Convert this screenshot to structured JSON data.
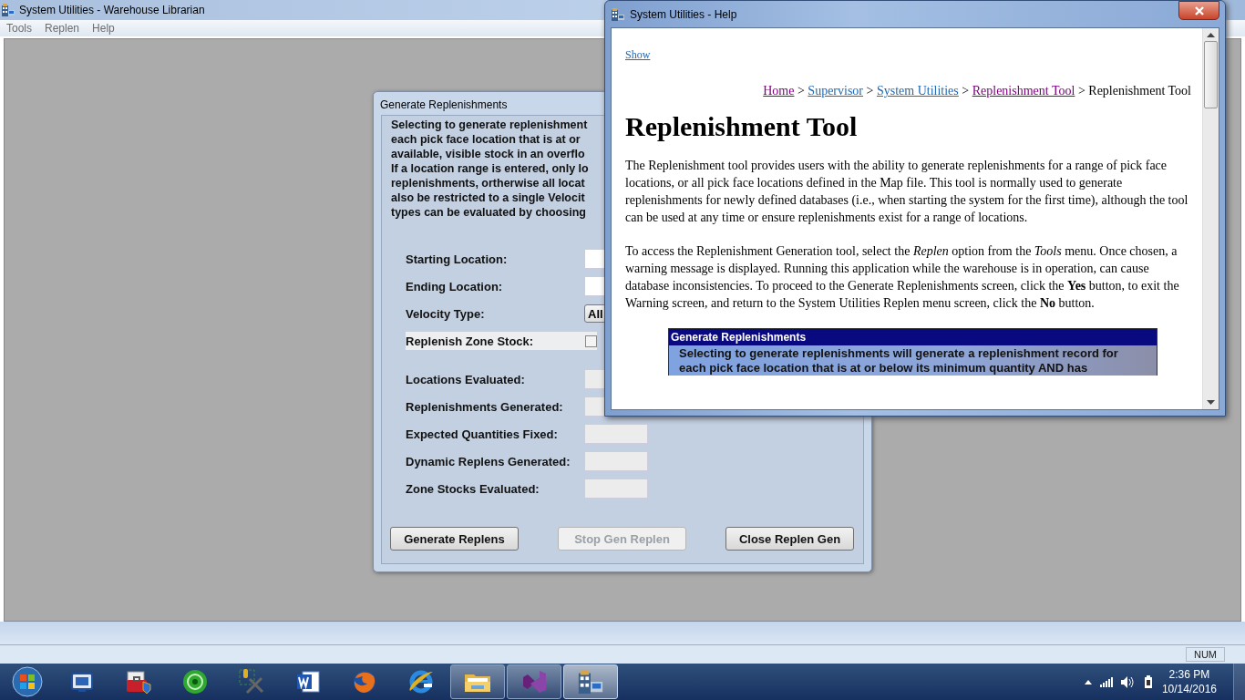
{
  "main_window": {
    "title": "System Utilities - Warehouse Librarian",
    "menu": [
      "Tools",
      "Replen",
      "Help"
    ]
  },
  "dialog": {
    "title": "Generate Replenishments",
    "intro_lines": [
      "Selecting to generate replenishment",
      "each pick face location that is at or",
      "available, visible stock in an overflo",
      "If a location range is entered, only lo",
      "replenishments, ortherwise all locat",
      "also be restricted to a single Velocit",
      "types can be evaluated by choosing"
    ],
    "fields": [
      {
        "label": "Starting Location:",
        "kind": "input"
      },
      {
        "label": "Ending Location:",
        "kind": "input"
      },
      {
        "label": "Velocity Type:",
        "kind": "select",
        "value": "All"
      },
      {
        "label": "Replenish Zone Stock:",
        "kind": "checkbox",
        "checked": false
      }
    ],
    "counters": [
      "Locations Evaluated:",
      "Replenishments Generated:",
      "Expected Quantities Fixed:",
      "Dynamic Replens Generated:",
      "Zone Stocks Evaluated:"
    ],
    "buttons": [
      {
        "label": "Generate Replens",
        "disabled": false
      },
      {
        "label": "Stop Gen Replen",
        "disabled": true
      },
      {
        "label": "Close Replen Gen",
        "disabled": false
      }
    ]
  },
  "help_window": {
    "title": "System Utilities  - Help",
    "show_link": "Show",
    "separator": ">",
    "breadcrumb": [
      {
        "label": "Home",
        "kind": "link",
        "visited": true
      },
      {
        "label": "Supervisor",
        "kind": "link",
        "visited": false
      },
      {
        "label": "System Utilities",
        "kind": "link",
        "visited": false
      },
      {
        "label": "Replenishment Tool",
        "kind": "link",
        "visited": true
      },
      {
        "label": "Replenishment Tool",
        "kind": "current",
        "visited": false
      }
    ],
    "heading": "Replenishment Tool",
    "paragraphs": [
      "The Replenishment tool provides users with the ability to generate replenishments for a range of pick face locations, or all pick face locations defined in the Map file. This tool is normally used to generate replenishments for newly defined databases (i.e., when starting the system for the first time), although the tool can be used at any time or ensure replenishments exist for a range of locations.",
      "To access the Replenishment Generation tool, select the *Replen* option from the *Tools* menu. Once chosen, a warning message is displayed. Running this application while the warehouse is in operation, can cause database inconsistencies. To proceed to the Generate Replenishments screen, click the **Yes** button, to exit the Warning screen, and return to the System Utilities Replen menu screen, click the **No** button."
    ],
    "figure": {
      "title": "Generate Replenishments",
      "lines": [
        "Selecting to generate replenishments will generate a replenishment record for",
        "each pick face location that is at or below its minimum quantity AND has"
      ]
    }
  },
  "status_bar": {
    "indicator": "NUM"
  },
  "taskbar": {
    "apps": [
      {
        "kind": "vb",
        "open": false,
        "active": false
      },
      {
        "kind": "toolbox",
        "open": false,
        "active": false
      },
      {
        "kind": "disc",
        "open": false,
        "active": false
      },
      {
        "kind": "tools",
        "open": false,
        "active": false
      },
      {
        "kind": "word",
        "open": false,
        "active": false
      },
      {
        "kind": "firefox",
        "open": false,
        "active": false
      },
      {
        "kind": "ie",
        "open": false,
        "active": false
      },
      {
        "kind": "folder",
        "open": true,
        "active": false
      },
      {
        "kind": "studio",
        "open": true,
        "active": false
      },
      {
        "kind": "warehouse",
        "open": true,
        "active": true
      }
    ],
    "time": "2:36 PM",
    "date": "10/14/2016"
  }
}
